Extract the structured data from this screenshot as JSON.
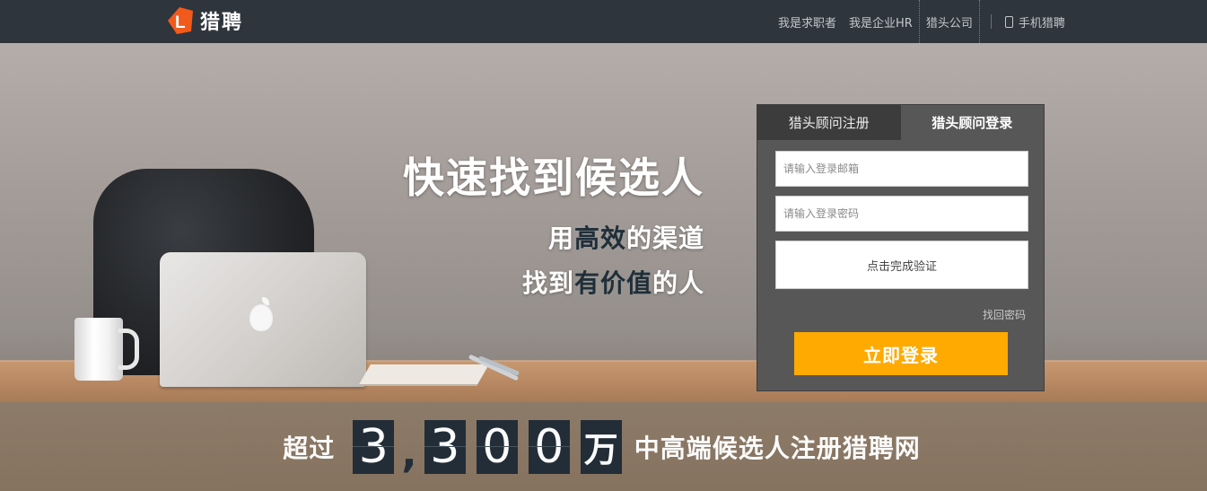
{
  "header": {
    "logo_letter": "L",
    "logo_text": "猎聘",
    "nav": {
      "job_seeker": "我是求职者",
      "hr": "我是企业HR",
      "headhunter_company": "猎头公司",
      "mobile": "手机猎聘"
    }
  },
  "hero": {
    "headline": "快速找到候选人",
    "line1": {
      "a": "用",
      "em": "高效",
      "b": "的渠道"
    },
    "line2": {
      "a": "找到",
      "em": "有价值",
      "b": "的人"
    }
  },
  "login": {
    "tab_register": "猎头顾问注册",
    "tab_login": "猎头顾问登录",
    "email_placeholder": "请输入登录邮箱",
    "password_placeholder": "请输入登录密码",
    "captcha_label": "点击完成验证",
    "forgot_label": "找回密码",
    "submit_label": "立即登录"
  },
  "stats": {
    "prefix": "超过",
    "digits": [
      "3",
      "3",
      "0",
      "0"
    ],
    "comma": ",",
    "unit": "万",
    "suffix": "中高端候选人注册猎聘网"
  },
  "colors": {
    "topbar": "#2f353d",
    "accent_orange": "#ffaa00",
    "logo_orange": "#f25a1b",
    "digit_bg": "#1e2a35"
  }
}
